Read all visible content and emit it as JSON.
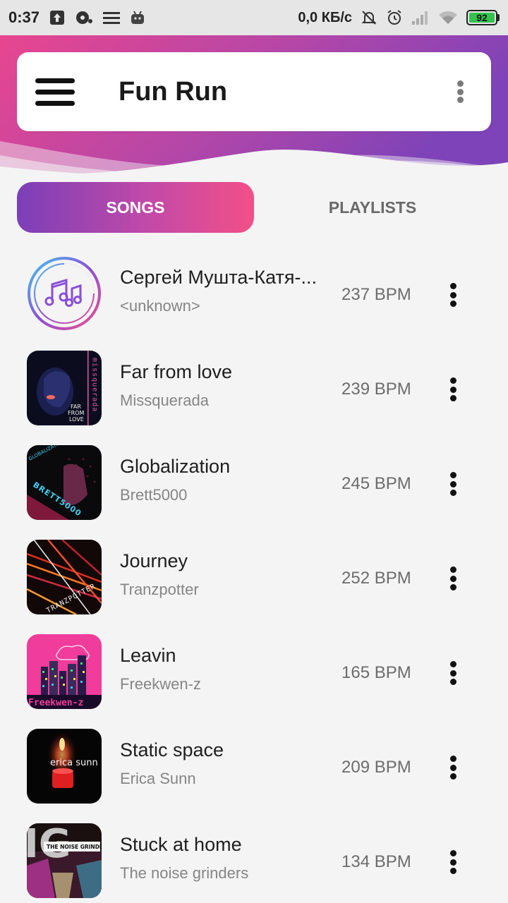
{
  "status_bar": {
    "time": "0:37",
    "net_speed": "0,0 КБ/с",
    "battery": "92"
  },
  "app": {
    "title": "Fun Run"
  },
  "tabs": [
    {
      "label": "SONGS",
      "active": true
    },
    {
      "label": "PLAYLISTS",
      "active": false
    }
  ],
  "songs": [
    {
      "title": "Сергей Мушта-Катя-...",
      "artist": "<unknown>",
      "bpm": "237 BPM",
      "art": "music-note-icon"
    },
    {
      "title": "Far from love",
      "artist": "Missquerada",
      "bpm": "239 BPM",
      "art": "album-far-from-love"
    },
    {
      "title": "Globalization",
      "artist": "Brett5000",
      "bpm": "245 BPM",
      "art": "album-globalization"
    },
    {
      "title": "Journey",
      "artist": "Tranzpotter",
      "bpm": "252 BPM",
      "art": "album-journey"
    },
    {
      "title": "Leavin",
      "artist": "Freekwen-z",
      "bpm": "165 BPM",
      "art": "album-leavin"
    },
    {
      "title": "Static space",
      "artist": "Erica Sunn",
      "bpm": "209 BPM",
      "art": "album-static-space"
    },
    {
      "title": "Stuck at home",
      "artist": "The noise grinders",
      "bpm": "134 BPM",
      "art": "album-stuck-at-home"
    }
  ],
  "artwork_text": {
    "far_from_love": [
      "FAR",
      "FROM",
      "LOVE"
    ],
    "missquerada_vertical": "missquerada",
    "globalization_top": "GLOBALIZATION",
    "brett5000": "BRETT5000",
    "tranzpotter": "TRANZPOTTER",
    "freekwen": "Freekwen-z",
    "erica_sunn": "erica sunn",
    "noise_grinders": "THE NOISE GRINDERS"
  },
  "colors": {
    "accent_start": "#7b3fb8",
    "accent_end": "#f24f88",
    "battery_green": "#33c24d"
  }
}
